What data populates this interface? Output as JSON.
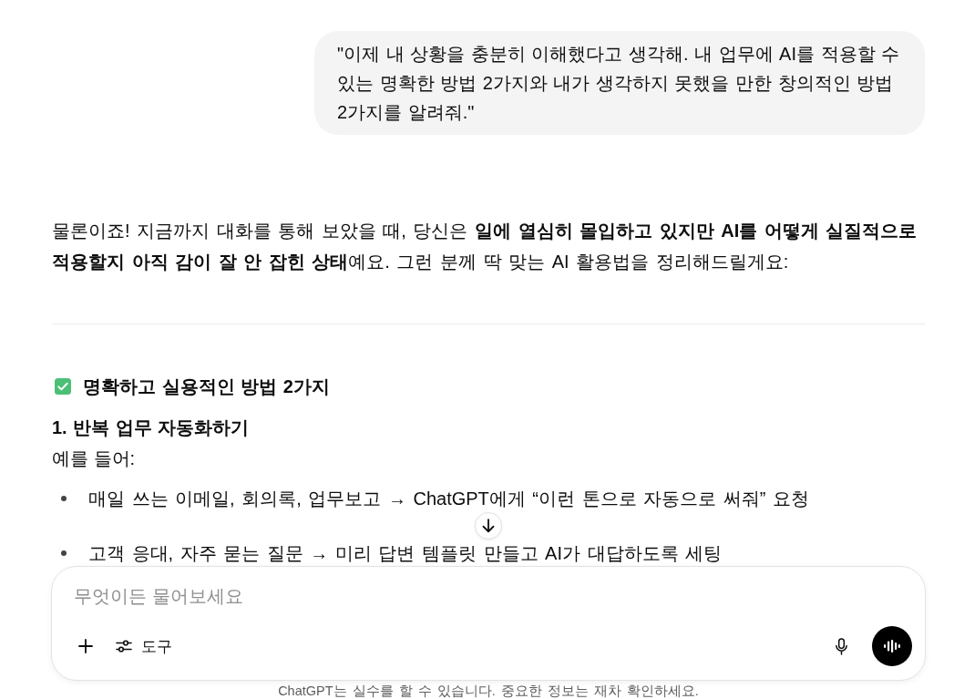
{
  "user_message": {
    "text": "\"이제 내 상황을 충분히 이해했다고 생각해. 내 업무에 AI를 적용할 수 있는 명확한 방법 2가지와 내가 생각하지 못했을 만한 창의적인 방법 2가지를 알려줘.\""
  },
  "assistant_message": {
    "intro": "물론이죠! 지금까지 대화를 통해 보았을 때, 당신은 **일에 열심히 몰입하고 있지만 AI를 어떻게 실질적으로 적용할지 아직 감이 잘 안 잡힌 상태**예요. 그런 분께 딱 맞는 AI 활용법을 정리해드릴게요:",
    "section_heading": "명확하고 실용적인 방법 2가지",
    "item_heading": "1. 반복 업무 자동화하기",
    "lead": "예를 들어:",
    "bullets": [
      "매일 쓰는 이메일, 회의록, 업무보고 → ChatGPT에게 “이런 톤으로 자동으로 써줘” 요청",
      "고객 응대, 자주 묻는 질문 → 미리 답변 템플릿 만들고 AI가 대답하도록 세팅"
    ]
  },
  "composer": {
    "placeholder": "무엇이든 물어보세요",
    "tools_label": "도구"
  },
  "disclaimer": "ChatGPT는 실수를 할 수 있습니다. 중요한 정보는 재차 확인하세요."
}
